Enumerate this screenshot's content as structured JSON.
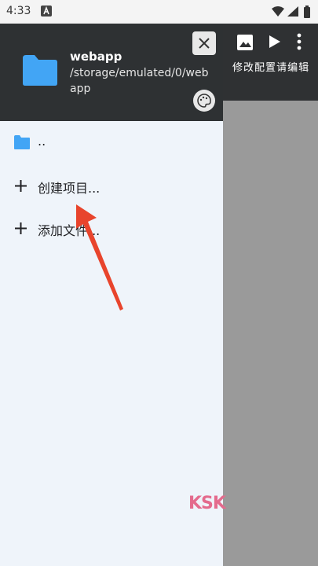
{
  "status_bar": {
    "time": "4:33"
  },
  "background_app": {
    "menu_items": [
      "修",
      "改",
      "配",
      "置",
      "请",
      "编",
      "辑"
    ]
  },
  "drawer": {
    "header": {
      "project_name": "webapp",
      "project_path": "/storage/emulated/0/webapp"
    },
    "items": [
      {
        "label": ".."
      },
      {
        "label": "创建项目..."
      },
      {
        "label": "添加文件..."
      }
    ]
  },
  "watermark": {
    "text": "KSK"
  },
  "colors": {
    "header_bg": "#2e3133",
    "drawer_bg": "#eff4fa",
    "folder_blue": "#42a5f5",
    "arrow_red": "#e8442c",
    "scrim": "#9b9b9b"
  }
}
